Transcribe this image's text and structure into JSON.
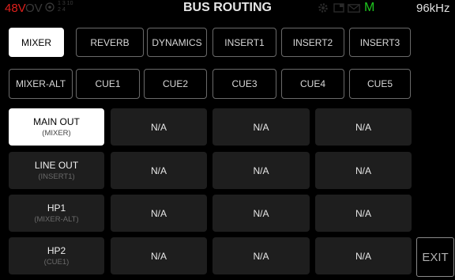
{
  "status": {
    "phantom": "48V",
    "overload": "OV",
    "chan_top": "1 3 10",
    "chan_bottom": "2 4",
    "title": "BUS ROUTING",
    "mode": "M",
    "sample_rate": "96kHz",
    "colors": {
      "phantom": "#e0201c",
      "mode": "#1ec41e"
    }
  },
  "bus_tabs_row1": [
    "MIXER",
    "REVERB",
    "DYNAMICS",
    "INSERT1",
    "INSERT2",
    "INSERT3"
  ],
  "bus_tabs_row2": [
    "MIXER-ALT",
    "CUE1",
    "CUE2",
    "CUE3",
    "CUE4",
    "CUE5"
  ],
  "selected_tab": "MIXER",
  "outputs": [
    {
      "name": "MAIN OUT",
      "source": "(MIXER)",
      "cells": [
        "N/A",
        "N/A",
        "N/A"
      ],
      "selected": true
    },
    {
      "name": "LINE OUT",
      "source": "(INSERT1)",
      "cells": [
        "N/A",
        "N/A",
        "N/A"
      ],
      "selected": false
    },
    {
      "name": "HP1",
      "source": "(MIXER-ALT)",
      "cells": [
        "N/A",
        "N/A",
        "N/A"
      ],
      "selected": false
    },
    {
      "name": "HP2",
      "source": "(CUE1)",
      "cells": [
        "N/A",
        "N/A",
        "N/A"
      ],
      "selected": false
    }
  ],
  "exit_label": "EXIT"
}
